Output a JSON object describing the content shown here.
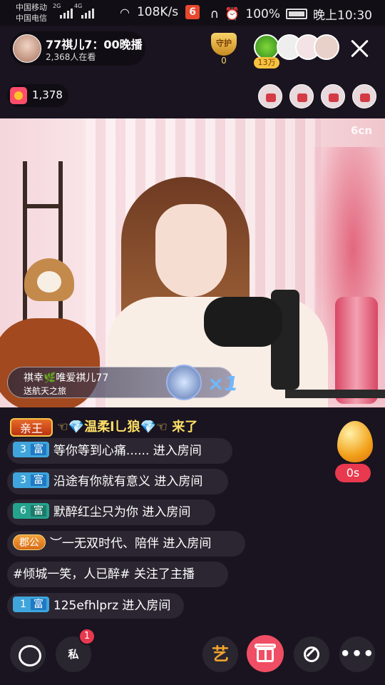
{
  "status_bar": {
    "carrier_1": "中国移动",
    "carrier_2": "中国电信",
    "net_1": "2G",
    "net_2": "4G",
    "speed": "108K/s",
    "app_badge": "6",
    "battery": "100%",
    "time": "晚上10:30"
  },
  "header": {
    "host_name": "77祺儿7：00晚播",
    "viewers": "2,368人在看",
    "guard_label": "守护",
    "guard_count": "0",
    "top_fan_badge": "13万",
    "coin_count": "1,378"
  },
  "video": {
    "watermark": "6cn"
  },
  "gift_banner": {
    "sender": "祺幸🌿唯爱祺儿77",
    "description": "送航天之旅",
    "multiplier": "×1"
  },
  "chat": {
    "king_badge": "亲王",
    "king_text": "☜💎温柔l乚狼💎☜ 来了",
    "messages": [
      {
        "level": "3",
        "tag": "富",
        "text": "等你等到心痛...... 进入房间"
      },
      {
        "level": "3",
        "tag": "富",
        "text": "沿途有你就有意义 进入房间"
      },
      {
        "level": "6",
        "tag": "富",
        "text": "默醉红尘只为你 进入房间"
      },
      {
        "badge": "郡公",
        "text": "︶一无双时代、陪伴 进入房间"
      },
      {
        "text": "#倾城一笑，人已醉#  关注了主播"
      },
      {
        "level": "1",
        "tag": "富",
        "text": "125efhlprz 进入房间"
      }
    ]
  },
  "egg": {
    "timer": "0s"
  },
  "bottom_bar": {
    "dm_label": "私",
    "dm_badge": "1",
    "art_label": "艺"
  }
}
